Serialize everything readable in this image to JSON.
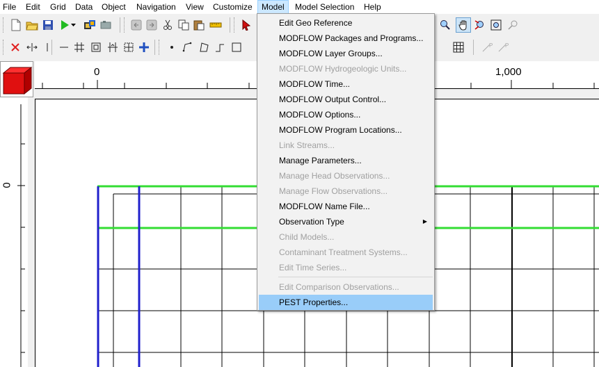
{
  "menubar": {
    "items": [
      "File",
      "Edit",
      "Grid",
      "Data",
      "Object",
      "Navigation",
      "View",
      "Customize",
      "Model",
      "Model Selection",
      "Help"
    ]
  },
  "ruler": {
    "top_labels": [
      "0",
      "1,000"
    ],
    "left_labels": [
      "0"
    ]
  },
  "model_menu": {
    "items": [
      {
        "label": "Edit Geo Reference",
        "enabled": true
      },
      {
        "label": "MODFLOW Packages and Programs...",
        "enabled": true
      },
      {
        "label": "MODFLOW Layer Groups...",
        "enabled": true
      },
      {
        "label": "MODFLOW Hydrogeologic Units...",
        "enabled": false
      },
      {
        "label": "MODFLOW Time...",
        "enabled": true
      },
      {
        "label": "MODFLOW Output Control...",
        "enabled": true
      },
      {
        "label": "MODFLOW Options...",
        "enabled": true
      },
      {
        "label": "MODFLOW Program Locations...",
        "enabled": true
      },
      {
        "label": "Link Streams...",
        "enabled": false
      },
      {
        "label": "Manage Parameters...",
        "enabled": true
      },
      {
        "label": "Manage Head Observations...",
        "enabled": false
      },
      {
        "label": "Manage Flow Observations...",
        "enabled": false
      },
      {
        "label": "MODFLOW Name File...",
        "enabled": true
      },
      {
        "label": "Observation Type",
        "enabled": true,
        "submenu": true
      },
      {
        "label": "Child Models...",
        "enabled": false
      },
      {
        "label": "Contaminant Treatment Systems...",
        "enabled": false
      },
      {
        "label": "Edit Time Series...",
        "enabled": false
      },
      {
        "label": "Edit Comparison Observations...",
        "enabled": false
      },
      {
        "label": "PEST Properties...",
        "enabled": true,
        "selected": true
      }
    ]
  },
  "colors": {
    "menu_highlight": "#99cdf9",
    "grid_line": "#000000",
    "green_line": "#33dd33",
    "blue_line": "#2020cc",
    "cube": "#e01010"
  }
}
